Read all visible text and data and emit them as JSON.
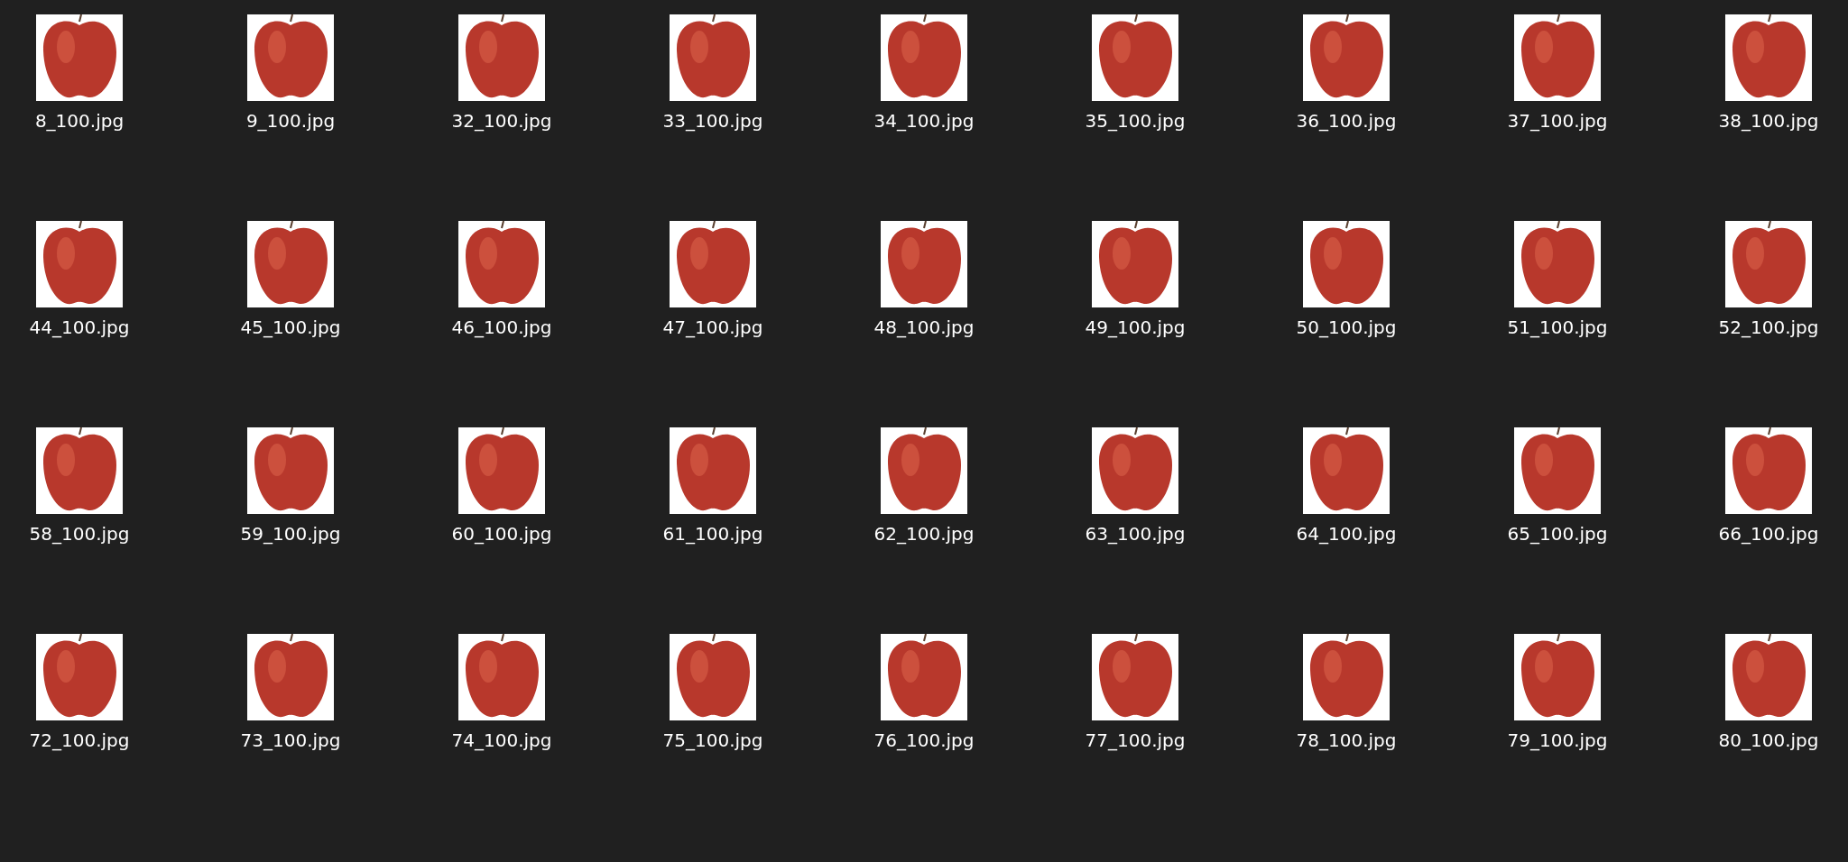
{
  "files": [
    {
      "name": "8_100.jpg"
    },
    {
      "name": "9_100.jpg"
    },
    {
      "name": "32_100.jpg"
    },
    {
      "name": "33_100.jpg"
    },
    {
      "name": "34_100.jpg"
    },
    {
      "name": "35_100.jpg"
    },
    {
      "name": "36_100.jpg"
    },
    {
      "name": "37_100.jpg"
    },
    {
      "name": "38_100.jpg"
    },
    {
      "name": "44_100.jpg"
    },
    {
      "name": "45_100.jpg"
    },
    {
      "name": "46_100.jpg"
    },
    {
      "name": "47_100.jpg"
    },
    {
      "name": "48_100.jpg"
    },
    {
      "name": "49_100.jpg"
    },
    {
      "name": "50_100.jpg"
    },
    {
      "name": "51_100.jpg"
    },
    {
      "name": "52_100.jpg"
    },
    {
      "name": "58_100.jpg"
    },
    {
      "name": "59_100.jpg"
    },
    {
      "name": "60_100.jpg"
    },
    {
      "name": "61_100.jpg"
    },
    {
      "name": "62_100.jpg"
    },
    {
      "name": "63_100.jpg"
    },
    {
      "name": "64_100.jpg"
    },
    {
      "name": "65_100.jpg"
    },
    {
      "name": "66_100.jpg"
    },
    {
      "name": "72_100.jpg"
    },
    {
      "name": "73_100.jpg"
    },
    {
      "name": "74_100.jpg"
    },
    {
      "name": "75_100.jpg"
    },
    {
      "name": "76_100.jpg"
    },
    {
      "name": "77_100.jpg"
    },
    {
      "name": "78_100.jpg"
    },
    {
      "name": "79_100.jpg"
    },
    {
      "name": "80_100.jpg"
    }
  ]
}
